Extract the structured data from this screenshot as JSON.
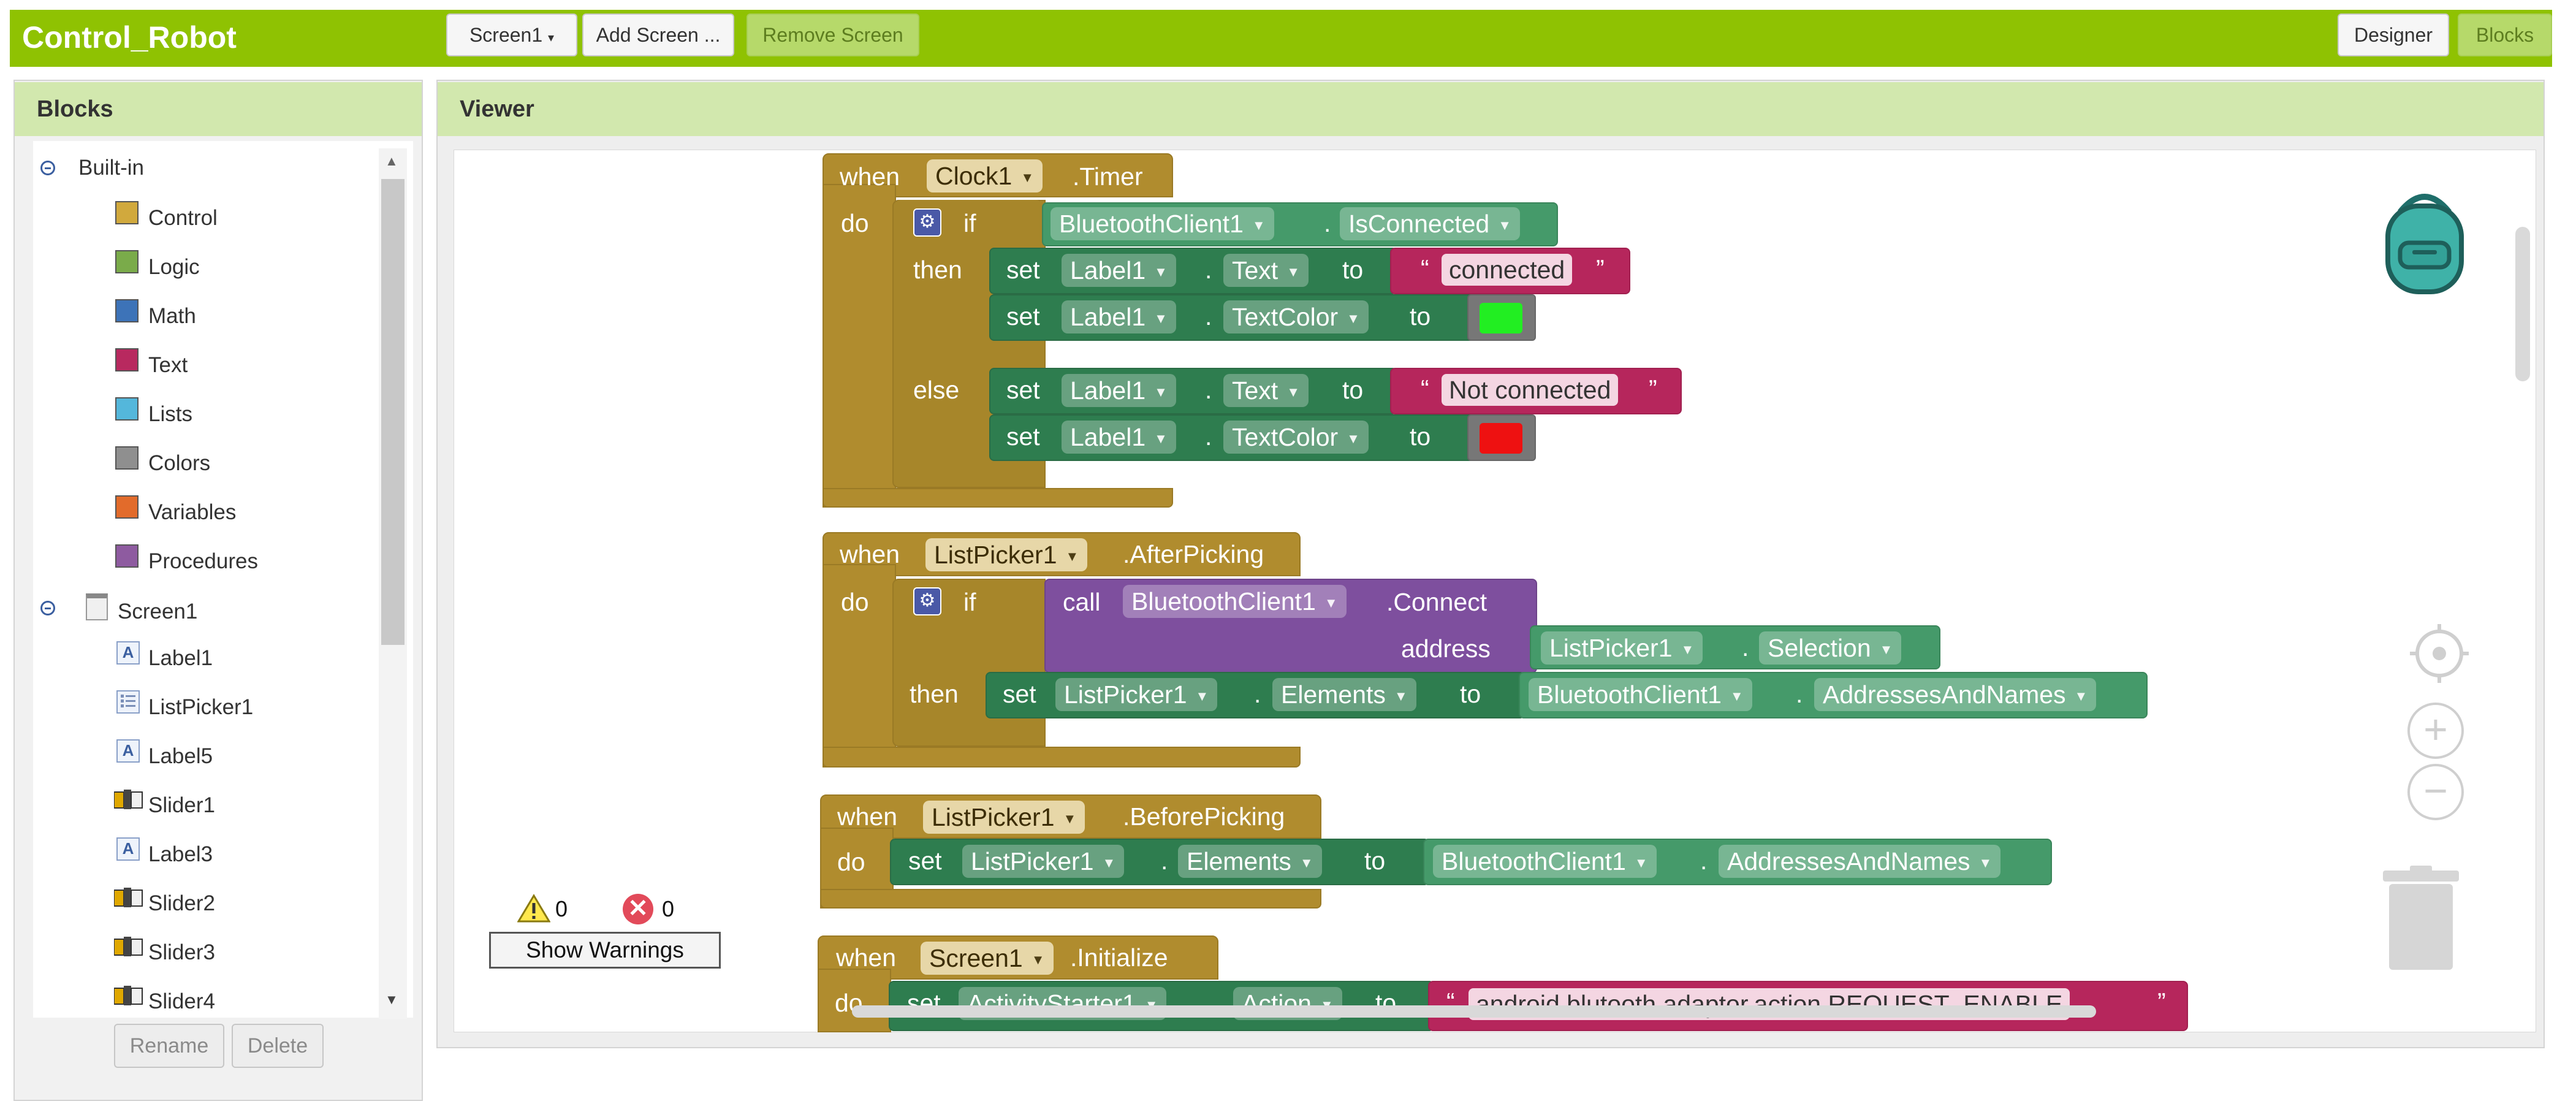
{
  "app": {
    "title": "Control_Robot",
    "accent_color": "#8fc202"
  },
  "toolbar": {
    "screen_select": "Screen1",
    "add_screen": "Add Screen ...",
    "remove_screen": "Remove Screen",
    "designer": "Designer",
    "blocks": "Blocks"
  },
  "blocks_panel": {
    "title": "Blocks",
    "builtin_label": "Built-in",
    "builtin": [
      {
        "label": "Control",
        "color": "#d1a93d"
      },
      {
        "label": "Logic",
        "color": "#7aab4a"
      },
      {
        "label": "Math",
        "color": "#3d73b8"
      },
      {
        "label": "Text",
        "color": "#b8295f"
      },
      {
        "label": "Lists",
        "color": "#54b7db"
      },
      {
        "label": "Colors",
        "color": "#8f8f8f"
      },
      {
        "label": "Variables",
        "color": "#e26b2b"
      },
      {
        "label": "Procedures",
        "color": "#8e5ba0"
      }
    ],
    "screen_label": "Screen1",
    "components": [
      {
        "label": "Label1",
        "icon": "label-icon"
      },
      {
        "label": "ListPicker1",
        "icon": "listpicker-icon"
      },
      {
        "label": "Label5",
        "icon": "label-icon"
      },
      {
        "label": "Slider1",
        "icon": "slider-icon"
      },
      {
        "label": "Label3",
        "icon": "label-icon"
      },
      {
        "label": "Slider2",
        "icon": "slider-icon"
      },
      {
        "label": "Slider3",
        "icon": "slider-icon"
      },
      {
        "label": "Slider4",
        "icon": "slider-icon"
      }
    ],
    "rename": "Rename",
    "delete": "Delete"
  },
  "viewer": {
    "title": "Viewer",
    "warnings_count": "0",
    "errors_count": "0",
    "show_warnings": "Show Warnings"
  },
  "blocks": {
    "when": "when",
    "do": "do",
    "if": "if",
    "then": "then",
    "else": "else",
    "set": "set",
    "to": "to",
    "call": "call",
    "dot": ".",
    "open_quote": "“",
    "close_quote": "”",
    "b1": {
      "component": "Clock1",
      "event": ".Timer",
      "bt": "BluetoothClient1",
      "prop": "IsConnected",
      "label": "Label1",
      "text_prop": "Text",
      "color_prop": "TextColor",
      "str_connected": "connected",
      "str_not_connected": "Not connected",
      "color_green": "#22ee22",
      "color_red": "#ee1111"
    },
    "b2": {
      "component": "ListPicker1",
      "event": ".AfterPicking",
      "bt": "BluetoothClient1",
      "method": ".Connect",
      "address": "address",
      "lp": "ListPicker1",
      "selection": "Selection",
      "elements": "Elements",
      "addrs": "AddressesAndNames"
    },
    "b3": {
      "component": "ListPicker1",
      "event": ".BeforePicking",
      "lp": "ListPicker1",
      "elements": "Elements",
      "bt": "BluetoothClient1",
      "addrs": "AddressesAndNames"
    },
    "b4": {
      "component": "Screen1",
      "event": ".Initialize",
      "activity": "ActivityStarter1",
      "action": "Action",
      "value": "android.blutooth.adaptor.action.REQUEST_ENABLE"
    }
  }
}
